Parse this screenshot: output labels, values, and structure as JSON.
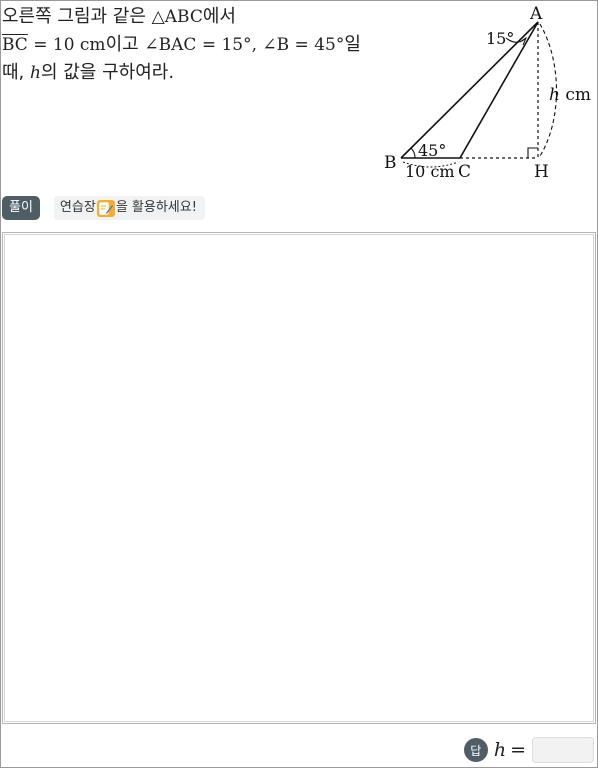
{
  "problem": {
    "line1_text": "오른쪽 그림과 같은 ",
    "line1_math": "△ABC",
    "line1_suffix": "에서",
    "line2_overline": "BC",
    "line2_math": " = 10 cm",
    "line2_text1": "이고 ",
    "line2_math2": "∠BAC = 15°, ∠B = 45°",
    "line2_text2": "일",
    "line3_text1": "때, ",
    "line3_var": "h",
    "line3_text2": "의 값을 구하여라."
  },
  "figure": {
    "label_A": "A",
    "label_B": "B",
    "label_C": "C",
    "label_H": "H",
    "angle_A": "15°",
    "angle_B": "45°",
    "side_BC": "10 cm",
    "height_var": "h",
    "height_unit": " cm"
  },
  "toolbar": {
    "solve_label": "풀이",
    "hint_prefix": "연습장",
    "hint_suffix": "을 활용하세요!"
  },
  "answer": {
    "badge": "답",
    "variable": "h",
    "equals": "="
  },
  "colors": {
    "badge": "#4f5d66",
    "pad_icon": "#f5ae2a",
    "border": "#9a9a9a"
  }
}
